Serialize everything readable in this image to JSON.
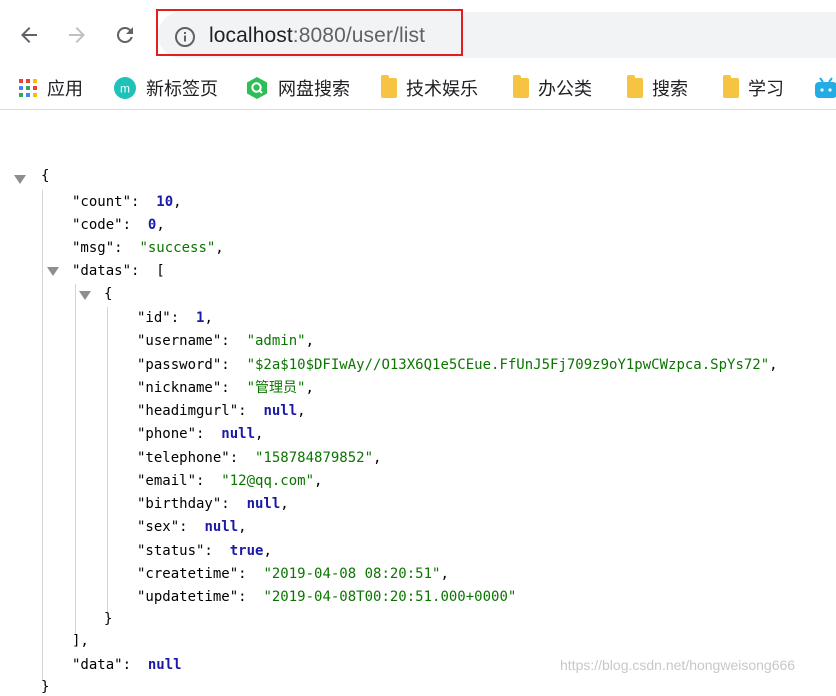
{
  "browser": {
    "url_host": "localhost",
    "url_rest": ":8080/user/list",
    "bookmarks": [
      {
        "label": "应用",
        "icon": "apps-grid-icon"
      },
      {
        "label": "新标签页",
        "icon": "new-tab-icon"
      },
      {
        "label": "网盘搜索",
        "icon": "netdisk-search-icon"
      },
      {
        "label": "技术娱乐",
        "icon": "folder-icon"
      },
      {
        "label": "办公类",
        "icon": "folder-icon"
      },
      {
        "label": "搜索",
        "icon": "folder-icon"
      },
      {
        "label": "学习",
        "icon": "folder-icon"
      }
    ]
  },
  "json": {
    "open_brace": "{",
    "close_brace": "}",
    "count_key": "\"count\":",
    "count_val": "10",
    "code_key": "\"code\":",
    "code_val": "0",
    "msg_key": "\"msg\":",
    "msg_val": "\"success\"",
    "datas_key": "\"datas\":",
    "datas_open": "[",
    "datas_close": "],",
    "item_open": "{",
    "item_close": "}",
    "fields": [
      {
        "key": "\"id\":",
        "value": "1",
        "type": "num"
      },
      {
        "key": "\"username\":",
        "value": "\"admin\"",
        "type": "str"
      },
      {
        "key": "\"password\":",
        "value": "\"$2a$10$DFIwAy//O13X6Q1e5CEue.FfUnJ5Fj709z9oY1pwCWzpca.SpYs72\"",
        "type": "str"
      },
      {
        "key": "\"nickname\":",
        "value": "\"管理员\"",
        "type": "str"
      },
      {
        "key": "\"headimgurl\":",
        "value": "null",
        "type": "nul"
      },
      {
        "key": "\"phone\":",
        "value": "null",
        "type": "nul"
      },
      {
        "key": "\"telephone\":",
        "value": "\"158784879852\"",
        "type": "str"
      },
      {
        "key": "\"email\":",
        "value": "\"12@qq.com\"",
        "type": "str"
      },
      {
        "key": "\"birthday\":",
        "value": "null",
        "type": "nul"
      },
      {
        "key": "\"sex\":",
        "value": "null",
        "type": "nul"
      },
      {
        "key": "\"status\":",
        "value": "true",
        "type": "bool"
      },
      {
        "key": "\"createtime\":",
        "value": "\"2019-04-08 08:20:51\"",
        "type": "str"
      },
      {
        "key": "\"updatetime\":",
        "value": "\"2019-04-08T00:20:51.000+0000\"",
        "type": "str"
      }
    ],
    "data_key": "\"data\":",
    "data_val": "null"
  },
  "watermark": "https://blog.csdn.net/hongweisong666",
  "colors": {
    "highlight_box": "#e02020",
    "string": "#0b7500",
    "number": "#1a1aa6"
  }
}
